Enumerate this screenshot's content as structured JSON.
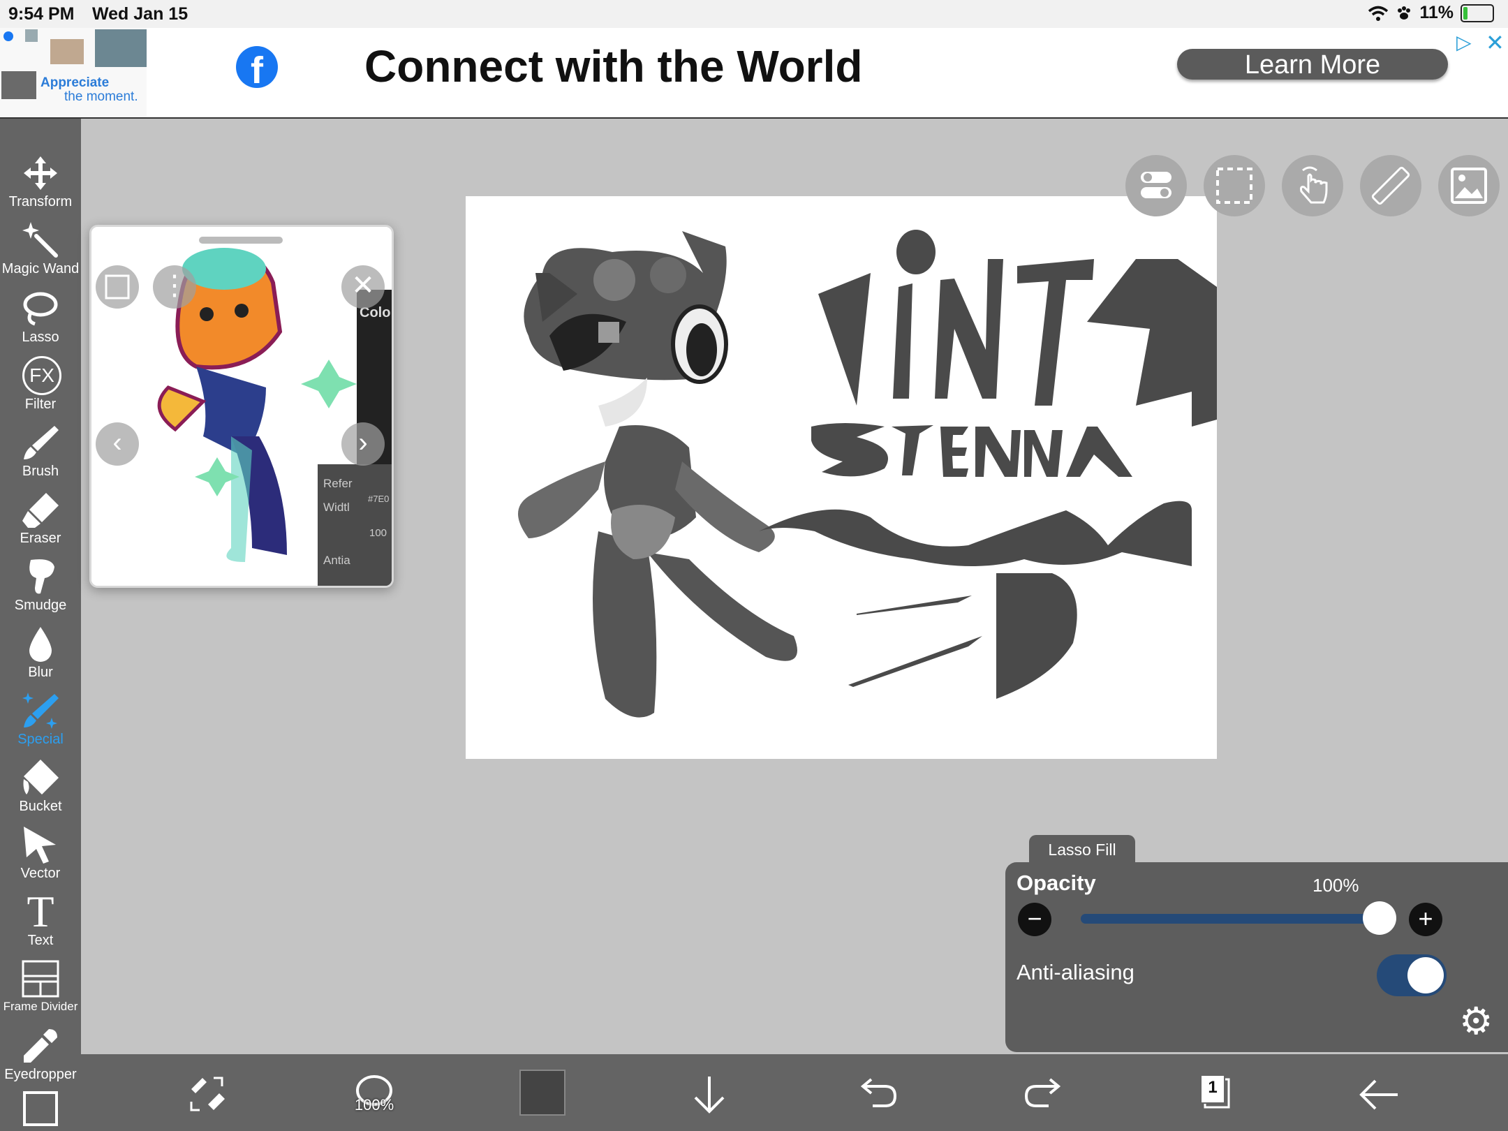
{
  "status": {
    "time": "9:54 PM",
    "date": "Wed Jan 15",
    "battery": "11%"
  },
  "ad": {
    "thumb_title": "Appreciate",
    "thumb_sub": "the moment.",
    "headline": "Connect with the World",
    "cta": "Learn More"
  },
  "tools": [
    {
      "label": "Transform",
      "icon": "transform-icon"
    },
    {
      "label": "Magic Wand",
      "icon": "magic-wand-icon"
    },
    {
      "label": "Lasso",
      "icon": "lasso-icon"
    },
    {
      "label": "Filter",
      "icon": "fx-icon",
      "glyph": "FX"
    },
    {
      "label": "Brush",
      "icon": "brush-icon"
    },
    {
      "label": "Eraser",
      "icon": "eraser-icon"
    },
    {
      "label": "Smudge",
      "icon": "smudge-icon"
    },
    {
      "label": "Blur",
      "icon": "blur-icon"
    },
    {
      "label": "Special",
      "icon": "special-icon",
      "active": true
    },
    {
      "label": "Bucket",
      "icon": "bucket-icon"
    },
    {
      "label": "Vector",
      "icon": "vector-icon"
    },
    {
      "label": "Text",
      "icon": "text-icon",
      "glyph": "T"
    },
    {
      "label": "Frame Divider",
      "icon": "frame-divider-icon"
    },
    {
      "label": "Eyedropper",
      "icon": "eyedropper-icon"
    }
  ],
  "reference": {
    "panel_title": "Colo",
    "refer": "Refer",
    "width": "Widtl",
    "hex": "#7E0",
    "val": "100",
    "antia": "Antia"
  },
  "props": {
    "tab": "Lasso Fill",
    "opacity_label": "Opacity",
    "opacity_value": "100%",
    "opacity": 1.0,
    "aa_label": "Anti-aliasing",
    "aa_on": true
  },
  "bottom": {
    "brush_size": "100%",
    "layer_count": "1"
  },
  "colors": {
    "toolbar": "#646464",
    "accent": "#2c9ff0",
    "slider": "#254a78"
  }
}
